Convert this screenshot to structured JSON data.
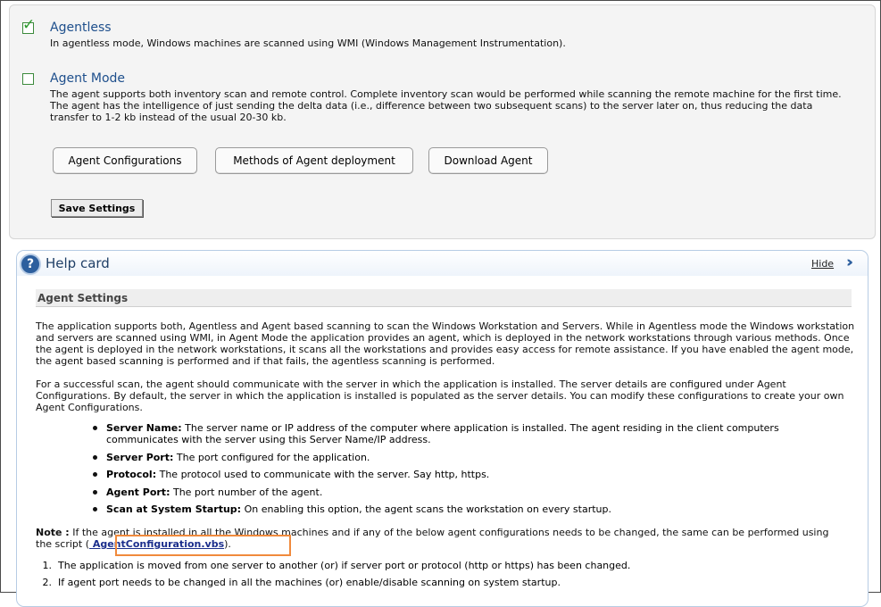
{
  "settings": {
    "agentless": {
      "checked": true,
      "title": "Agentless",
      "description": "In agentless mode, Windows machines are scanned using WMI (Windows Management Instrumentation)."
    },
    "agent_mode": {
      "checked": false,
      "title": "Agent Mode",
      "description": "The agent supports both inventory scan and remote control. Complete inventory scan would be performed while scanning the remote machine for the first time. The agent has the intelligence of just sending the delta data (i.e., difference between two subsequent scans) to the server later on, thus reducing the data transfer to 1-2 kb instead of the usual 20-30 kb."
    },
    "buttons": {
      "agent_configurations": "Agent Configurations",
      "methods_of_deployment": "Methods of Agent deployment",
      "download_agent": "Download Agent"
    },
    "save_label": "Save Settings"
  },
  "help_card": {
    "title": "Help card",
    "hide_label": "Hide",
    "section_heading": "Agent Settings",
    "paragraph_1": "The application supports both, Agentless and Agent based scanning to scan the Windows Workstation and Servers. While in Agentless mode the Windows workstation and servers are scanned using WMI, in Agent Mode the application provides an agent, which is deployed in the network workstations through various methods. Once the agent is deployed in the network workstations, it scans all the workstations and provides easy access for remote assistance. If you have enabled the agent mode, the agent based scanning is performed and if that fails, the agentless scanning is performed.",
    "paragraph_2": "For a successful scan, the agent should communicate with the server in which the application is installed. The server details are configured under Agent Configurations. By default, the server in which the application is installed is populated as the server details. You can modify these configurations to create your own Agent Configurations.",
    "settings_list": [
      {
        "term": "Server Name:",
        "text": "The server name or IP address of the computer where application is installed. The agent residing in the client computers communicates with the server using this Server Name/IP address."
      },
      {
        "term": "Server Port:",
        "text": "The port configured for the application."
      },
      {
        "term": "Protocol:",
        "text": "The protocol used to communicate with the server. Say http, https."
      },
      {
        "term": "Agent Port:",
        "text": "The port number of the agent."
      },
      {
        "term": "Scan at System Startup:",
        "text": "On enabling this option, the agent scans the workstation on every startup."
      }
    ],
    "note": {
      "label": "Note :",
      "text": " If the agent is installed in all the Windows machines and if any of the below agent configurations needs to be changed, the same can be performed using the script (",
      "link": " AgentConfiguration.vbs",
      "suffix": ")."
    },
    "steps": [
      {
        "num": "1.",
        "text": "The application is moved from one server to another (or) if server port or protocol (http or https) has been changed."
      },
      {
        "num": "2.",
        "text": "If agent port needs to be changed in all the machines (or) enable/disable scanning on system startup."
      }
    ]
  }
}
